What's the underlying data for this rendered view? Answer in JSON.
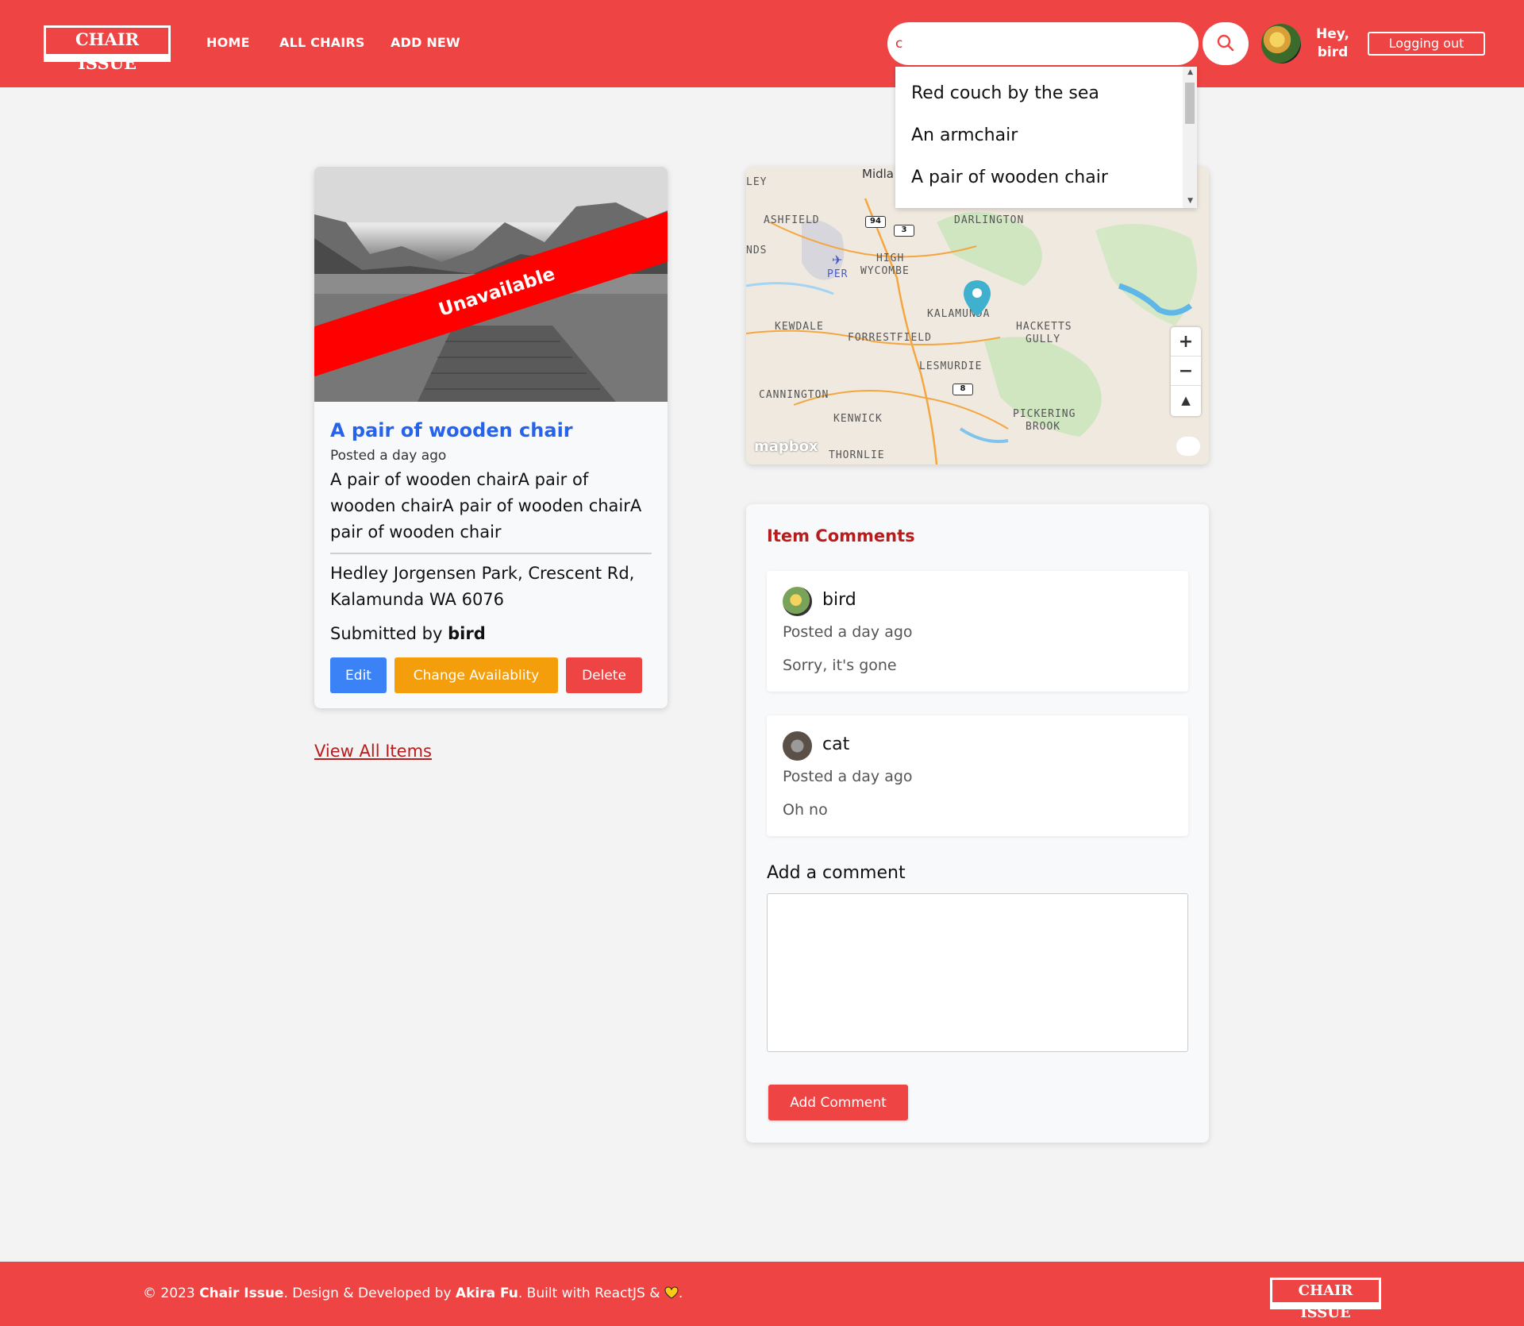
{
  "header": {
    "logo": "CHAIR ISSUE",
    "nav": [
      "HOME",
      "ALL CHAIRS",
      "ADD NEW"
    ],
    "search_value": "c",
    "greeting": "Hey, bird",
    "logout_label": "Logging out"
  },
  "search_dropdown": {
    "options": [
      "Red couch by the sea",
      "An armchair",
      "A pair of wooden chair"
    ]
  },
  "item": {
    "badge": "Unavailable",
    "title": "A pair of wooden chair",
    "posted": "Posted a day ago",
    "description": "A pair of wooden chairA pair of wooden chairA pair of wooden chairA pair of wooden chair",
    "address": "Hedley Jorgensen Park, Crescent Rd, Kalamunda WA 6076",
    "submitted_prefix": "Submitted by",
    "submitted_user": "bird",
    "buttons": {
      "edit": "Edit",
      "change": "Change Availablity",
      "delete": "Delete"
    }
  },
  "view_all": "View All Items",
  "map": {
    "labels": [
      "LEY",
      "Midla",
      "ASHFIELD",
      "DARLINGTON",
      "NDS",
      "HIGH",
      "WYCOMBE",
      "PER",
      "KALAMUNDA",
      "KEWDALE",
      "FORRESTFIELD",
      "HACKETTS",
      "GULLY",
      "LESMURDIE",
      "CANNINGTON",
      "KENWICK",
      "PICKERING",
      "BROOK",
      "THORNLIE"
    ],
    "shields": [
      "94",
      "3",
      "8"
    ],
    "zoom_in": "+",
    "zoom_out": "−",
    "attribution": "mapbox"
  },
  "comments": {
    "title": "Item Comments",
    "items": [
      {
        "user": "bird",
        "posted": "Posted a day ago",
        "text": "Sorry, it's gone"
      },
      {
        "user": "cat",
        "posted": "Posted a day ago",
        "text": "Oh no"
      }
    ],
    "add_label": "Add a comment",
    "add_button": "Add Comment"
  },
  "footer": {
    "copyright": "© 2023",
    "brand": "Chair Issue",
    "design_text": ". Design & Developed by",
    "author": "Akira Fu",
    "built_text": ". Built with ReactJS &",
    "end": ".",
    "logo": "CHAIR ISSUE"
  },
  "colors": {
    "brand_red": "#ef4444",
    "title_blue": "#2563eb",
    "edit_blue": "#3b82f6",
    "change_orange": "#f59e0b",
    "ribbon_red": "#ff0000",
    "comments_red": "#b91c1c"
  }
}
